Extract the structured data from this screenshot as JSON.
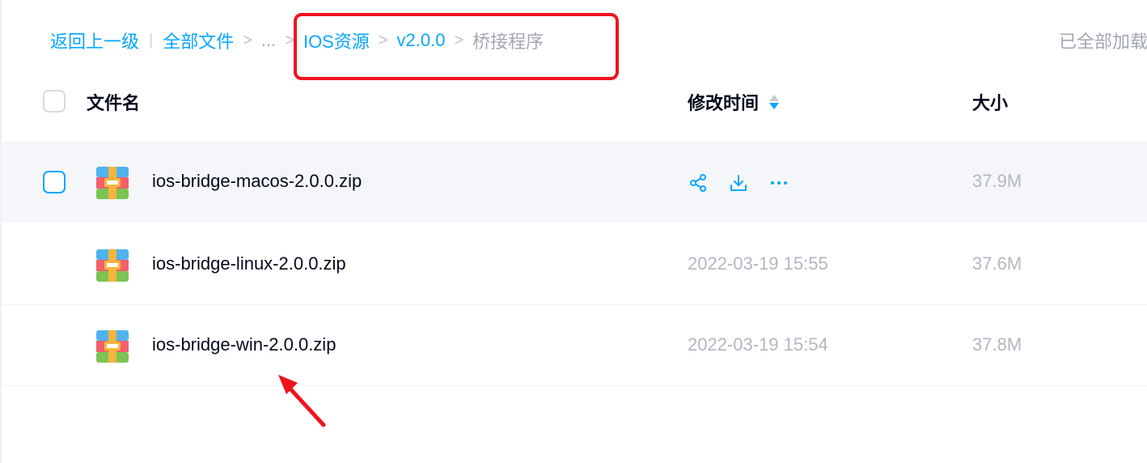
{
  "breadcrumb": {
    "back": "返回上一级",
    "all_files": "全部文件",
    "ellipsis": "...",
    "ios_resources": "IOS资源",
    "version": "v2.0.0",
    "current": "桥接程序",
    "separator": ">",
    "divider": "|"
  },
  "status": {
    "loaded": "已全部加载"
  },
  "columns": {
    "name": "文件名",
    "modified": "修改时间",
    "size": "大小"
  },
  "files": [
    {
      "name": "ios-bridge-macos-2.0.0.zip",
      "modified": "",
      "size": "37.9M",
      "hovered": true
    },
    {
      "name": "ios-bridge-linux-2.0.0.zip",
      "modified": "2022-03-19 15:55",
      "size": "37.6M"
    },
    {
      "name": "ios-bridge-win-2.0.0.zip",
      "modified": "2022-03-19 15:54",
      "size": "37.8M"
    }
  ],
  "icons": {
    "file_type": "zip-archive-icon",
    "share": "share-icon",
    "download": "download-icon",
    "more": "more-icon",
    "sort": "sort-icon"
  },
  "colors": {
    "accent": "#06a7ff",
    "annotation": "#f0141e",
    "text_primary": "#03081a",
    "text_secondary": "#b3b7c0",
    "row_hover": "#f5f6f9"
  }
}
